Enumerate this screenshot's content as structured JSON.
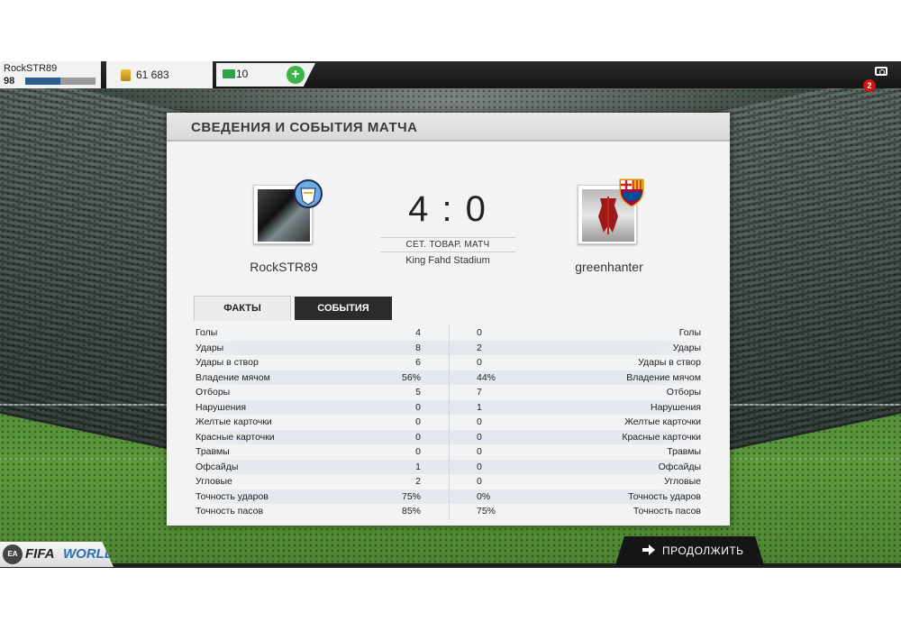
{
  "topbar": {
    "player_name": "RockSTR89",
    "player_level": "98",
    "xp_progress": 0.5,
    "coins": "61 683",
    "points": "10",
    "notifications": "2"
  },
  "dialog": {
    "title": "СВЕДЕНИЯ И СОБЫТИЯ МАТЧА",
    "home_team": "RockSTR89",
    "away_team": "greenhanter",
    "score": "4 : 0",
    "match_type": "СЕТ. ТОВАР. МАТЧ",
    "stadium": "King Fahd Stadium",
    "tabs": {
      "facts": "ФАКТЫ",
      "events": "СОБЫТИЯ"
    },
    "stats": [
      {
        "label": "Голы",
        "home": "4",
        "away": "0"
      },
      {
        "label": "Удары",
        "home": "8",
        "away": "2"
      },
      {
        "label": "Удары в створ",
        "home": "6",
        "away": "0"
      },
      {
        "label": "Владение мячом",
        "home": "56%",
        "away": "44%"
      },
      {
        "label": "Отборы",
        "home": "5",
        "away": "7"
      },
      {
        "label": "Нарушения",
        "home": "0",
        "away": "1"
      },
      {
        "label": "Желтые карточки",
        "home": "0",
        "away": "0"
      },
      {
        "label": "Красные карточки",
        "home": "0",
        "away": "0"
      },
      {
        "label": "Травмы",
        "home": "0",
        "away": "0"
      },
      {
        "label": "Офсайды",
        "home": "1",
        "away": "0"
      },
      {
        "label": "Угловые",
        "home": "2",
        "away": "0"
      },
      {
        "label": "Точность ударов",
        "home": "75%",
        "away": "0%"
      },
      {
        "label": "Точность пасов",
        "home": "85%",
        "away": "75%"
      }
    ]
  },
  "footer": {
    "continue_label": "ПРОДОЛЖИТЬ",
    "logo_ea": "EA",
    "logo_fifa": "FIFA",
    "logo_world": "WORLD"
  },
  "colors": {
    "accent_green": "#3bb54a",
    "xp_blue": "#2f5c8f",
    "badge_red": "#d01515"
  }
}
